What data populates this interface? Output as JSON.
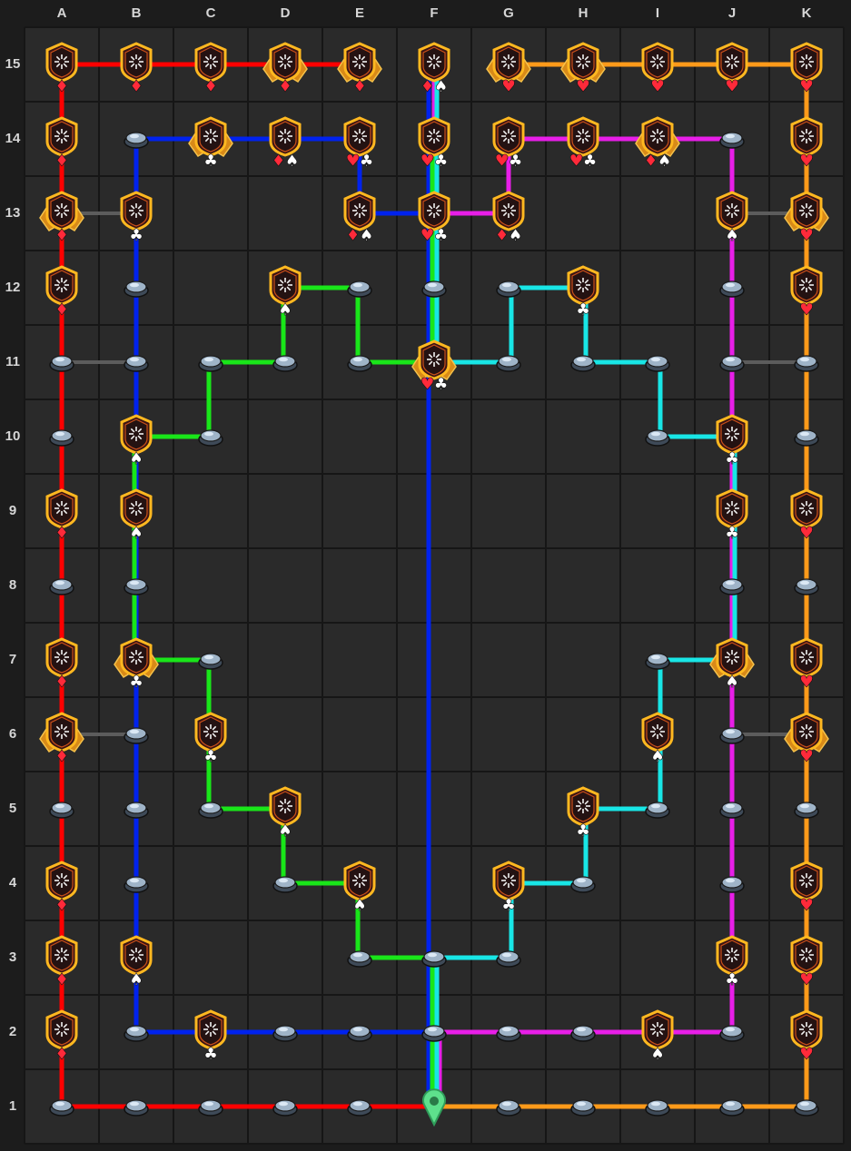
{
  "board": {
    "columns": [
      "A",
      "B",
      "C",
      "D",
      "E",
      "F",
      "G",
      "H",
      "I",
      "J",
      "K"
    ],
    "rows": [
      "1",
      "2",
      "3",
      "4",
      "5",
      "6",
      "7",
      "8",
      "9",
      "10",
      "11",
      "12",
      "13",
      "14",
      "15"
    ]
  },
  "colors": {
    "red": "#ff0000",
    "orange": "#ff9a1a",
    "blue": "#0022ee",
    "green": "#19e619",
    "cyan": "#18e6e6",
    "magenta": "#e81ee8",
    "gray": "#5c5c5c",
    "grid_bg": "#2a2a2a",
    "grid_line": "#161616",
    "heart": "#ff2a3a",
    "diamond": "#ff2a3a",
    "club": "#ffffff",
    "spade": "#ffffff",
    "badge_border": "#ffb820",
    "badge_fill": "#3a1414",
    "start_marker": "#5ee08c"
  },
  "start": {
    "col": "F",
    "row": 1,
    "icon": "map-pin-icon"
  },
  "paths": [
    {
      "color": "red",
      "points": [
        [
          "A",
          1
        ],
        [
          "F",
          1
        ]
      ]
    },
    {
      "color": "red",
      "points": [
        [
          "A",
          1
        ],
        [
          "A",
          15
        ],
        [
          "E",
          15
        ]
      ]
    },
    {
      "color": "orange",
      "points": [
        [
          "F",
          1
        ],
        [
          "K",
          1
        ],
        [
          "K",
          15
        ],
        [
          "G",
          15
        ]
      ]
    },
    {
      "color": "blue",
      "points": [
        [
          "F",
          2
        ],
        [
          "B",
          2
        ],
        [
          "B",
          14
        ],
        [
          "E",
          14
        ],
        [
          "E",
          13
        ],
        [
          "F",
          13
        ]
      ]
    },
    {
      "color": "blue",
      "points": [
        [
          "F",
          1
        ],
        [
          "F",
          15
        ]
      ],
      "offset": -6
    },
    {
      "color": "green",
      "points": [
        [
          "F",
          1
        ],
        [
          "F",
          3
        ],
        [
          "E",
          3
        ],
        [
          "E",
          4
        ],
        [
          "D",
          4
        ],
        [
          "D",
          5
        ],
        [
          "C",
          5
        ],
        [
          "C",
          7
        ],
        [
          "B",
          7
        ],
        [
          "B",
          10
        ],
        [
          "C",
          10
        ],
        [
          "C",
          11
        ],
        [
          "D",
          11
        ],
        [
          "D",
          12
        ],
        [
          "E",
          12
        ],
        [
          "E",
          11
        ],
        [
          "F",
          11
        ],
        [
          "F",
          14
        ]
      ]
    },
    {
      "color": "cyan",
      "points": [
        [
          "F",
          1
        ],
        [
          "F",
          3
        ],
        [
          "G",
          3
        ],
        [
          "G",
          4
        ],
        [
          "H",
          4
        ],
        [
          "H",
          5
        ],
        [
          "I",
          5
        ],
        [
          "I",
          7
        ],
        [
          "J",
          7
        ],
        [
          "J",
          10
        ],
        [
          "I",
          10
        ],
        [
          "I",
          11
        ],
        [
          "H",
          11
        ],
        [
          "H",
          12
        ],
        [
          "G",
          12
        ],
        [
          "G",
          11
        ],
        [
          "F",
          11
        ],
        [
          "F",
          15
        ]
      ]
    },
    {
      "color": "magenta",
      "points": [
        [
          "F",
          2
        ],
        [
          "J",
          2
        ],
        [
          "J",
          14
        ],
        [
          "G",
          14
        ],
        [
          "G",
          13
        ],
        [
          "F",
          13
        ],
        [
          "F",
          15
        ]
      ]
    },
    {
      "color": "magenta",
      "points": [
        [
          "F",
          1
        ],
        [
          "F",
          2
        ]
      ],
      "offset": 6
    },
    {
      "color": "gray",
      "points": [
        [
          "A",
          13
        ],
        [
          "B",
          13
        ]
      ]
    },
    {
      "color": "gray",
      "points": [
        [
          "A",
          11
        ],
        [
          "B",
          11
        ]
      ]
    },
    {
      "color": "gray",
      "points": [
        [
          "A",
          6
        ],
        [
          "B",
          6
        ]
      ]
    },
    {
      "color": "gray",
      "points": [
        [
          "J",
          13
        ],
        [
          "K",
          13
        ]
      ]
    },
    {
      "color": "gray",
      "points": [
        [
          "J",
          11
        ],
        [
          "K",
          11
        ]
      ]
    },
    {
      "color": "gray",
      "points": [
        [
          "J",
          6
        ],
        [
          "K",
          6
        ]
      ]
    }
  ],
  "badges": [
    {
      "col": "A",
      "row": 15,
      "suits": [
        "diamond"
      ]
    },
    {
      "col": "B",
      "row": 15,
      "suits": [
        "diamond"
      ]
    },
    {
      "col": "C",
      "row": 15,
      "suits": [
        "diamond"
      ]
    },
    {
      "col": "D",
      "row": 15,
      "suits": [
        "diamond"
      ],
      "winged": true
    },
    {
      "col": "E",
      "row": 15,
      "suits": [
        "diamond"
      ],
      "winged": true
    },
    {
      "col": "F",
      "row": 15,
      "suits": [
        "diamond",
        "spade"
      ]
    },
    {
      "col": "G",
      "row": 15,
      "suits": [
        "heart"
      ],
      "winged": true
    },
    {
      "col": "H",
      "row": 15,
      "suits": [
        "heart"
      ],
      "winged": true
    },
    {
      "col": "I",
      "row": 15,
      "suits": [
        "heart"
      ]
    },
    {
      "col": "J",
      "row": 15,
      "suits": [
        "heart"
      ]
    },
    {
      "col": "K",
      "row": 15,
      "suits": [
        "heart"
      ]
    },
    {
      "col": "A",
      "row": 14,
      "suits": [
        "diamond"
      ]
    },
    {
      "col": "C",
      "row": 14,
      "suits": [
        "club"
      ],
      "winged": true
    },
    {
      "col": "D",
      "row": 14,
      "suits": [
        "diamond",
        "spade"
      ]
    },
    {
      "col": "E",
      "row": 14,
      "suits": [
        "heart",
        "club"
      ]
    },
    {
      "col": "F",
      "row": 14,
      "suits": [
        "heart",
        "club"
      ]
    },
    {
      "col": "G",
      "row": 14,
      "suits": [
        "heart",
        "club"
      ]
    },
    {
      "col": "H",
      "row": 14,
      "suits": [
        "heart",
        "club"
      ]
    },
    {
      "col": "I",
      "row": 14,
      "suits": [
        "diamond",
        "spade"
      ],
      "winged": true
    },
    {
      "col": "K",
      "row": 14,
      "suits": [
        "heart"
      ]
    },
    {
      "col": "A",
      "row": 13,
      "suits": [
        "diamond"
      ],
      "winged": true
    },
    {
      "col": "B",
      "row": 13,
      "suits": [
        "club"
      ]
    },
    {
      "col": "E",
      "row": 13,
      "suits": [
        "diamond",
        "spade"
      ]
    },
    {
      "col": "F",
      "row": 13,
      "suits": [
        "heart",
        "club"
      ]
    },
    {
      "col": "G",
      "row": 13,
      "suits": [
        "diamond",
        "spade"
      ]
    },
    {
      "col": "J",
      "row": 13,
      "suits": [
        "spade"
      ]
    },
    {
      "col": "K",
      "row": 13,
      "suits": [
        "heart"
      ],
      "winged": true
    },
    {
      "col": "A",
      "row": 12,
      "suits": [
        "diamond"
      ]
    },
    {
      "col": "D",
      "row": 12,
      "suits": [
        "spade"
      ]
    },
    {
      "col": "H",
      "row": 12,
      "suits": [
        "club"
      ]
    },
    {
      "col": "K",
      "row": 12,
      "suits": [
        "heart"
      ]
    },
    {
      "col": "F",
      "row": 11,
      "suits": [
        "heart",
        "club"
      ],
      "winged": true
    },
    {
      "col": "B",
      "row": 10,
      "suits": [
        "spade"
      ]
    },
    {
      "col": "J",
      "row": 10,
      "suits": [
        "club"
      ]
    },
    {
      "col": "A",
      "row": 9,
      "suits": [
        "diamond"
      ]
    },
    {
      "col": "B",
      "row": 9,
      "suits": [
        "spade"
      ]
    },
    {
      "col": "J",
      "row": 9,
      "suits": [
        "club"
      ]
    },
    {
      "col": "K",
      "row": 9,
      "suits": [
        "heart"
      ]
    },
    {
      "col": "A",
      "row": 7,
      "suits": [
        "diamond"
      ]
    },
    {
      "col": "B",
      "row": 7,
      "suits": [
        "club"
      ],
      "winged": true
    },
    {
      "col": "J",
      "row": 7,
      "suits": [
        "spade"
      ],
      "winged": true
    },
    {
      "col": "K",
      "row": 7,
      "suits": [
        "heart"
      ]
    },
    {
      "col": "A",
      "row": 6,
      "suits": [
        "diamond"
      ],
      "winged": true
    },
    {
      "col": "C",
      "row": 6,
      "suits": [
        "club"
      ]
    },
    {
      "col": "I",
      "row": 6,
      "suits": [
        "spade"
      ]
    },
    {
      "col": "K",
      "row": 6,
      "suits": [
        "heart"
      ],
      "winged": true
    },
    {
      "col": "D",
      "row": 5,
      "suits": [
        "spade"
      ]
    },
    {
      "col": "H",
      "row": 5,
      "suits": [
        "club"
      ]
    },
    {
      "col": "A",
      "row": 4,
      "suits": [
        "diamond"
      ]
    },
    {
      "col": "E",
      "row": 4,
      "suits": [
        "spade"
      ]
    },
    {
      "col": "G",
      "row": 4,
      "suits": [
        "club"
      ]
    },
    {
      "col": "K",
      "row": 4,
      "suits": [
        "heart"
      ]
    },
    {
      "col": "A",
      "row": 3,
      "suits": [
        "diamond"
      ]
    },
    {
      "col": "B",
      "row": 3,
      "suits": [
        "spade"
      ]
    },
    {
      "col": "J",
      "row": 3,
      "suits": [
        "club"
      ]
    },
    {
      "col": "K",
      "row": 3,
      "suits": [
        "heart"
      ]
    },
    {
      "col": "A",
      "row": 2,
      "suits": [
        "diamond"
      ]
    },
    {
      "col": "C",
      "row": 2,
      "suits": [
        "club"
      ]
    },
    {
      "col": "I",
      "row": 2,
      "suits": [
        "spade"
      ]
    },
    {
      "col": "K",
      "row": 2,
      "suits": [
        "heart"
      ]
    }
  ],
  "nodes": [
    [
      "A",
      1
    ],
    [
      "B",
      1
    ],
    [
      "C",
      1
    ],
    [
      "D",
      1
    ],
    [
      "E",
      1
    ],
    [
      "G",
      1
    ],
    [
      "H",
      1
    ],
    [
      "I",
      1
    ],
    [
      "J",
      1
    ],
    [
      "K",
      1
    ],
    [
      "B",
      2
    ],
    [
      "D",
      2
    ],
    [
      "E",
      2
    ],
    [
      "F",
      2
    ],
    [
      "G",
      2
    ],
    [
      "H",
      2
    ],
    [
      "J",
      2
    ],
    [
      "E",
      3
    ],
    [
      "F",
      3
    ],
    [
      "G",
      3
    ],
    [
      "B",
      4
    ],
    [
      "D",
      4
    ],
    [
      "H",
      4
    ],
    [
      "J",
      4
    ],
    [
      "A",
      5
    ],
    [
      "B",
      5
    ],
    [
      "C",
      5
    ],
    [
      "I",
      5
    ],
    [
      "J",
      5
    ],
    [
      "K",
      5
    ],
    [
      "B",
      6
    ],
    [
      "J",
      6
    ],
    [
      "C",
      7
    ],
    [
      "I",
      7
    ],
    [
      "A",
      8
    ],
    [
      "B",
      8
    ],
    [
      "J",
      8
    ],
    [
      "K",
      8
    ],
    [
      "A",
      10
    ],
    [
      "C",
      10
    ],
    [
      "I",
      10
    ],
    [
      "K",
      10
    ],
    [
      "A",
      11
    ],
    [
      "B",
      11
    ],
    [
      "C",
      11
    ],
    [
      "D",
      11
    ],
    [
      "E",
      11
    ],
    [
      "G",
      11
    ],
    [
      "H",
      11
    ],
    [
      "I",
      11
    ],
    [
      "J",
      11
    ],
    [
      "K",
      11
    ],
    [
      "B",
      12
    ],
    [
      "E",
      12
    ],
    [
      "F",
      12
    ],
    [
      "G",
      12
    ],
    [
      "J",
      12
    ],
    [
      "B",
      14
    ],
    [
      "J",
      14
    ]
  ]
}
